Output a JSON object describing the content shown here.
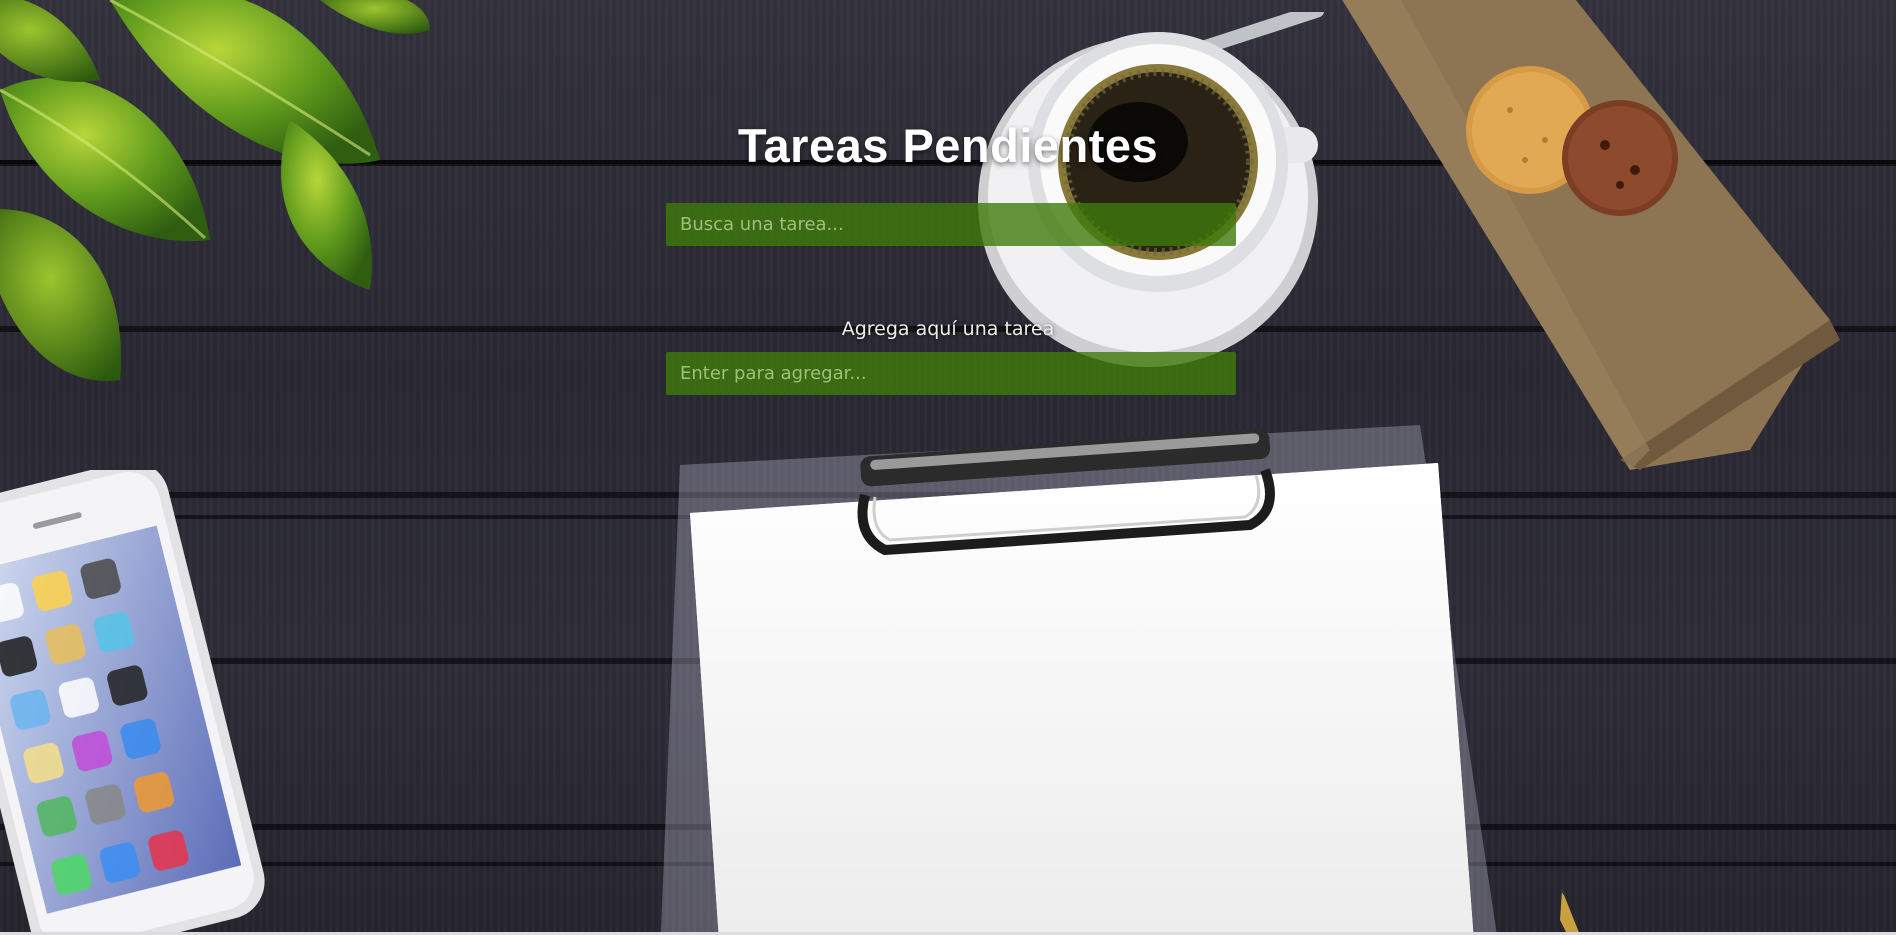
{
  "app": {
    "title": "Tareas Pendientes"
  },
  "search": {
    "placeholder": "Busca una tarea..."
  },
  "add_task": {
    "label": "Agrega aquí una tarea",
    "placeholder": "Enter para agregar..."
  },
  "colors": {
    "input_background": "#3e7a0a",
    "title_text": "#ffffff",
    "desk_wood": "#2e2d38"
  },
  "decor": {
    "plant": "plant-icon",
    "coffee": "coffee-cup-icon",
    "napkin": "napkin-icon",
    "cookies": "cookie-icon",
    "phone": "smartphone-icon",
    "clipboard": "clipboard-icon",
    "pen": "pen-icon"
  }
}
